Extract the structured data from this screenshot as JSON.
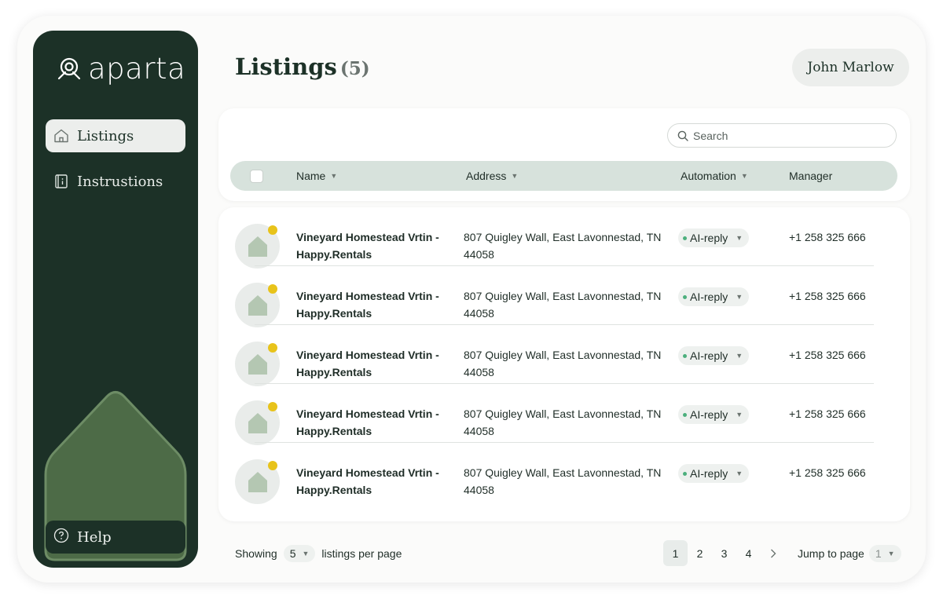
{
  "app": {
    "brand": "aparta"
  },
  "sidebar": {
    "items": [
      {
        "label": "Listings",
        "icon": "home-icon",
        "active": true
      },
      {
        "label": "Instrustions",
        "icon": "book-icon",
        "active": false
      }
    ],
    "help_label": "Help"
  },
  "header": {
    "title": "Listings",
    "count": "(5)",
    "user": "John Marlow"
  },
  "search": {
    "placeholder": "Search"
  },
  "table": {
    "columns": [
      "Name",
      "Address",
      "Automation",
      "Manager"
    ],
    "rows": [
      {
        "name": "Vineyard Homestead Vrtin - Happy.Rentals",
        "address": "807 Quigley Wall, East Lavonnestad, TN 44058",
        "automation": "AI-reply",
        "manager": "+1 258 325 666"
      },
      {
        "name": "Vineyard Homestead Vrtin - Happy.Rentals",
        "address": "807 Quigley Wall, East Lavonnestad, TN 44058",
        "automation": "AI-reply",
        "manager": "+1 258 325 666"
      },
      {
        "name": "Vineyard Homestead Vrtin - Happy.Rentals",
        "address": "807 Quigley Wall, East Lavonnestad, TN 44058",
        "automation": "AI-reply",
        "manager": "+1 258 325 666"
      },
      {
        "name": "Vineyard Homestead Vrtin - Happy.Rentals",
        "address": "807 Quigley Wall, East Lavonnestad, TN 44058",
        "automation": "AI-reply",
        "manager": "+1 258 325 666"
      },
      {
        "name": "Vineyard Homestead Vrtin - Happy.Rentals",
        "address": "807 Quigley Wall, East Lavonnestad, TN 44058",
        "automation": "AI-reply",
        "manager": "+1 258 325 666"
      }
    ]
  },
  "footer": {
    "showing_label": "Showing",
    "per_page_value": "5",
    "per_page_suffix": "listings per page",
    "pages": [
      "1",
      "2",
      "3",
      "4"
    ],
    "current_page": "1",
    "jump_label": "Jump to page",
    "jump_value": "1"
  },
  "colors": {
    "sidebar_bg": "#1c3127",
    "header_row_bg": "#d7e2dc",
    "status_dot": "#e8c31a",
    "automation_dot": "#4caf7d"
  }
}
